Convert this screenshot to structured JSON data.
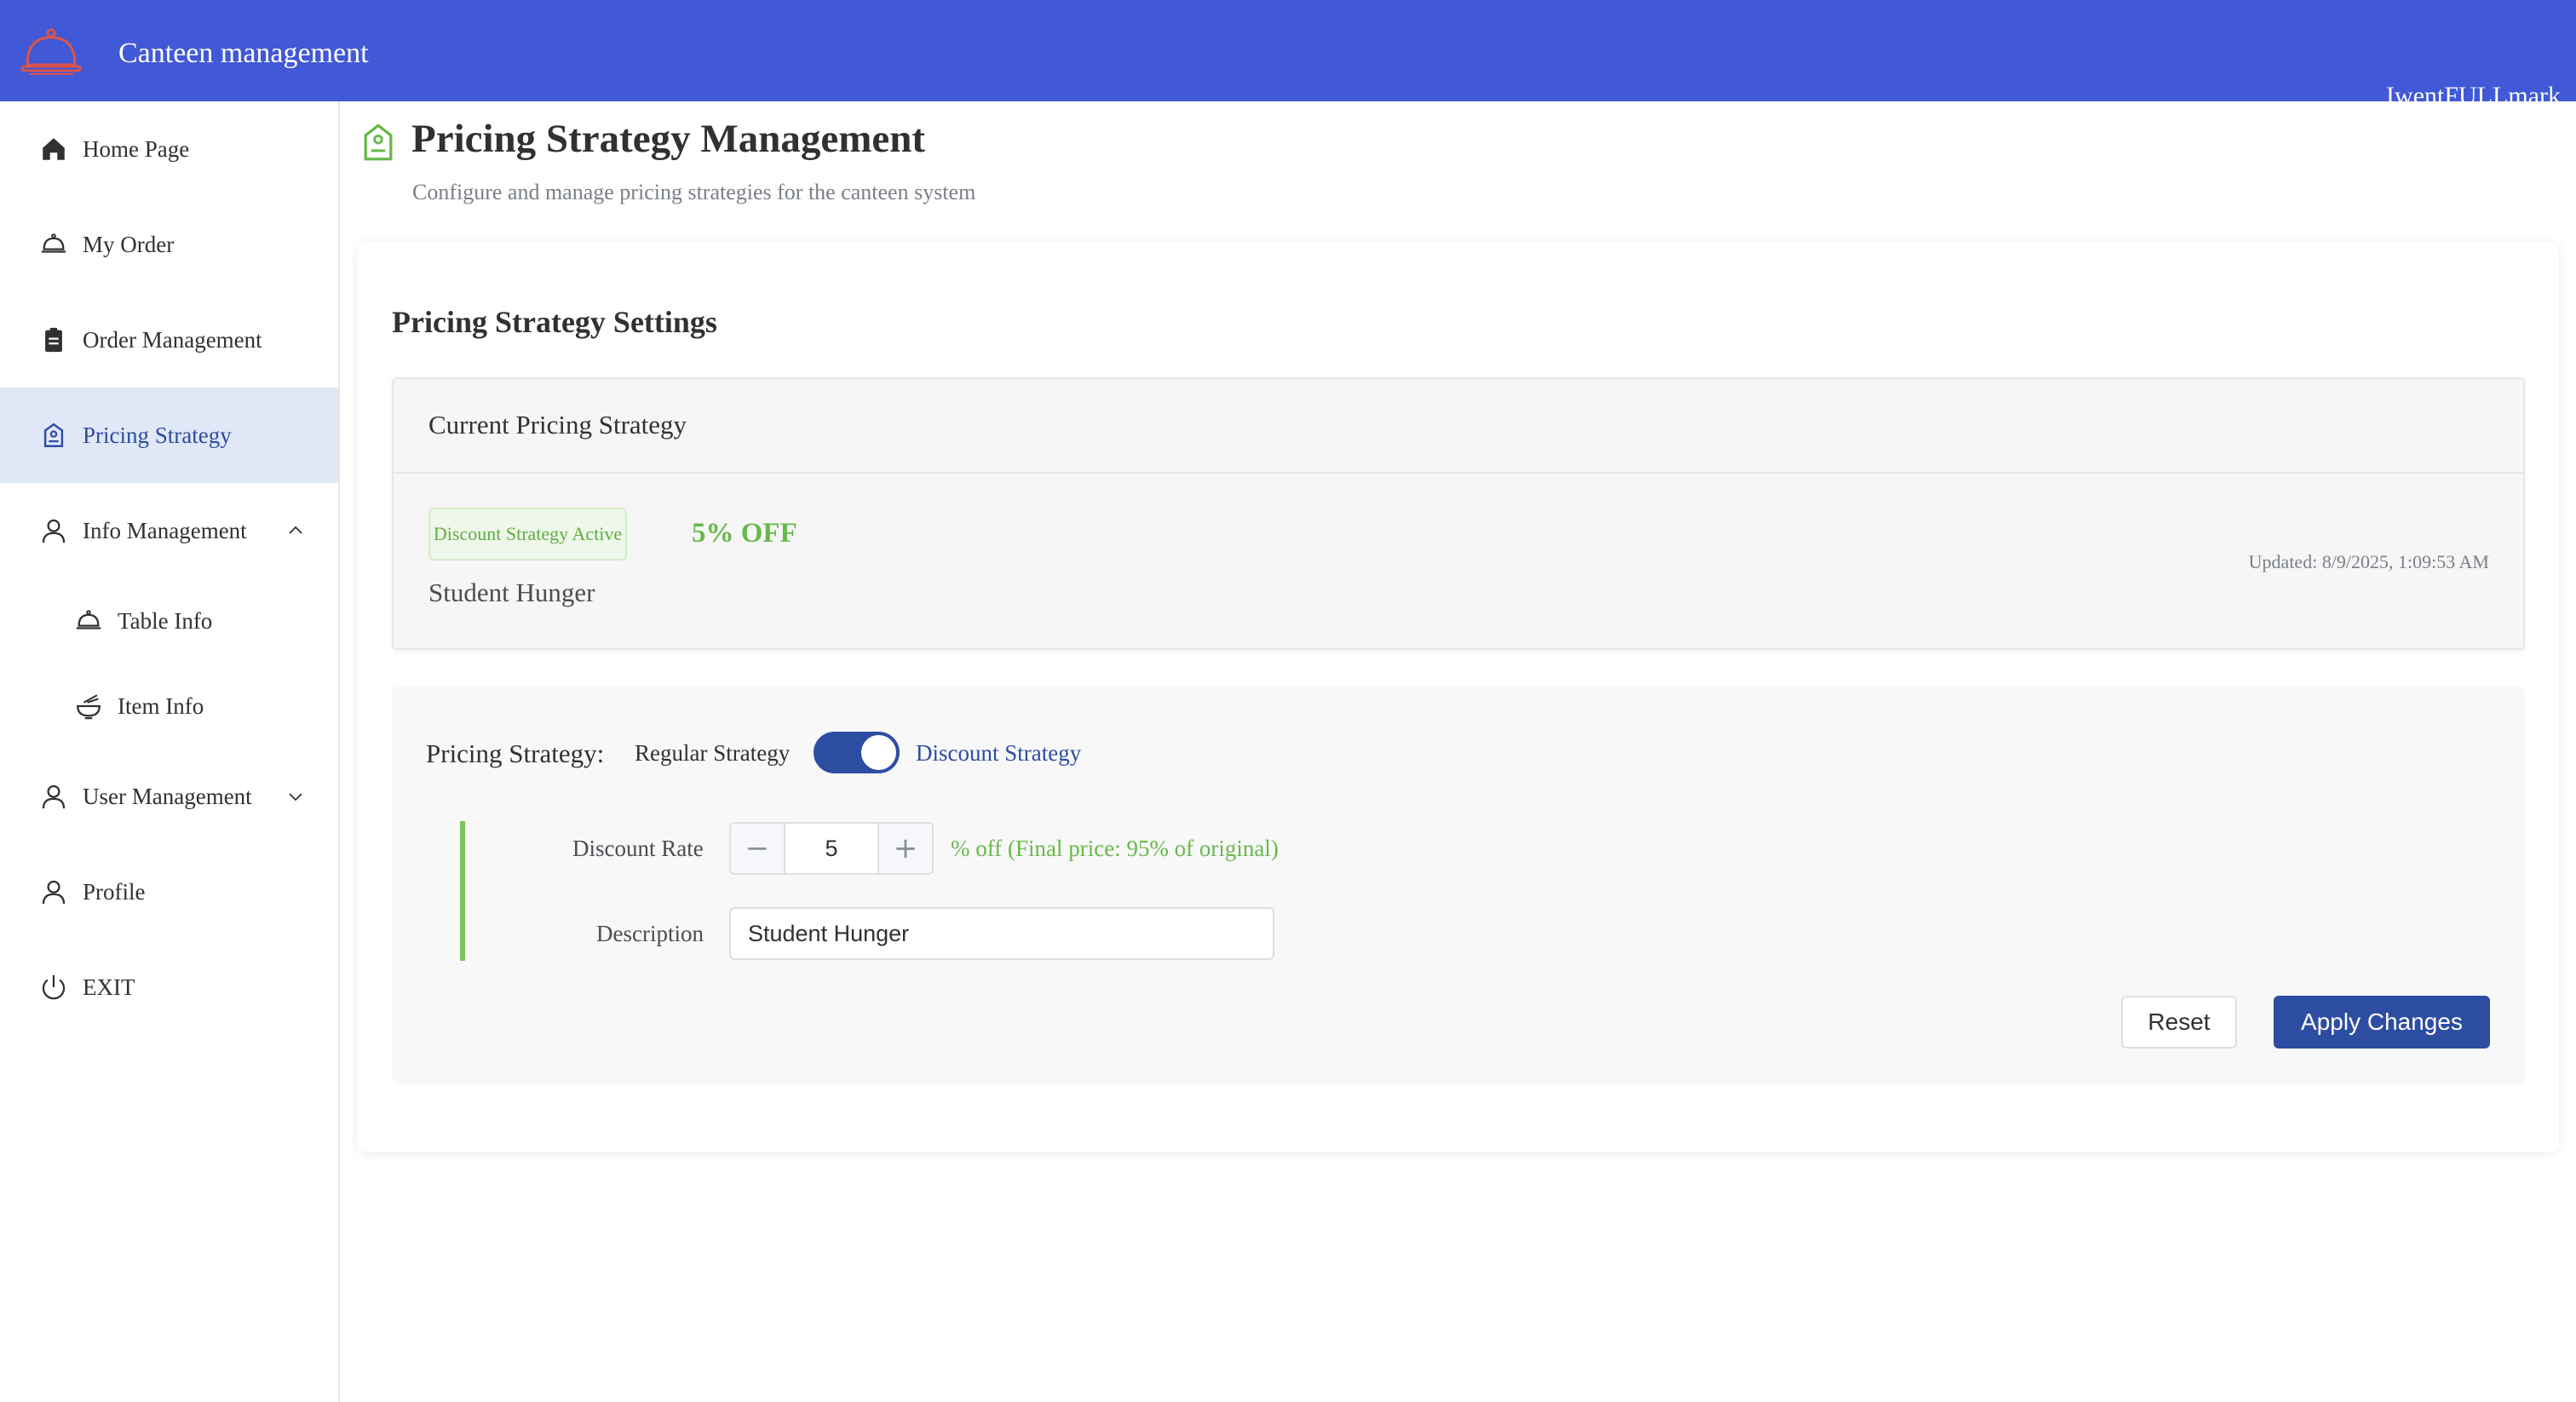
{
  "header": {
    "app_title": "Canteen management",
    "user_name": "IwentFULLmark",
    "bg_color": "#4159d6"
  },
  "sidebar": {
    "items": [
      {
        "label": "Home Page",
        "icon": "home-icon"
      },
      {
        "label": "My Order",
        "icon": "cloche-icon"
      },
      {
        "label": "Order Management",
        "icon": "clipboard-icon"
      },
      {
        "label": "Pricing Strategy",
        "icon": "price-tag-icon",
        "active": true
      },
      {
        "label": "Info Management",
        "icon": "user-icon",
        "expanded": true
      },
      {
        "label": "Table Info",
        "icon": "cloche-icon",
        "sub": true
      },
      {
        "label": "Item Info",
        "icon": "bowl-icon",
        "sub": true
      },
      {
        "label": "User Management",
        "icon": "user-icon",
        "expanded": false
      },
      {
        "label": "Profile",
        "icon": "user-icon"
      },
      {
        "label": "EXIT",
        "icon": "power-icon"
      }
    ],
    "active_color": "#2d4da2"
  },
  "page": {
    "title": "Pricing Strategy Management",
    "subtitle": "Configure and manage pricing strategies for the canteen system"
  },
  "settings": {
    "title": "Pricing Strategy Settings",
    "current": {
      "title": "Current Pricing Strategy",
      "tag": "Discount Strategy Active",
      "off_text": "5% OFF",
      "description": "Student Hunger",
      "updated": "Updated: 8/9/2025, 1:09:53 AM"
    },
    "form": {
      "strategy_label": "Pricing Strategy:",
      "regular_label": "Regular Strategy",
      "discount_label": "Discount Strategy",
      "toggle_on": true,
      "rate_label": "Discount Rate",
      "rate_minus": "−",
      "rate_value": "5",
      "rate_plus": "+",
      "rate_hint": "% off (Final price: 95% of original)",
      "desc_label": "Description",
      "desc_value": "Student Hunger",
      "reset_label": "Reset",
      "apply_label": "Apply Changes"
    }
  }
}
